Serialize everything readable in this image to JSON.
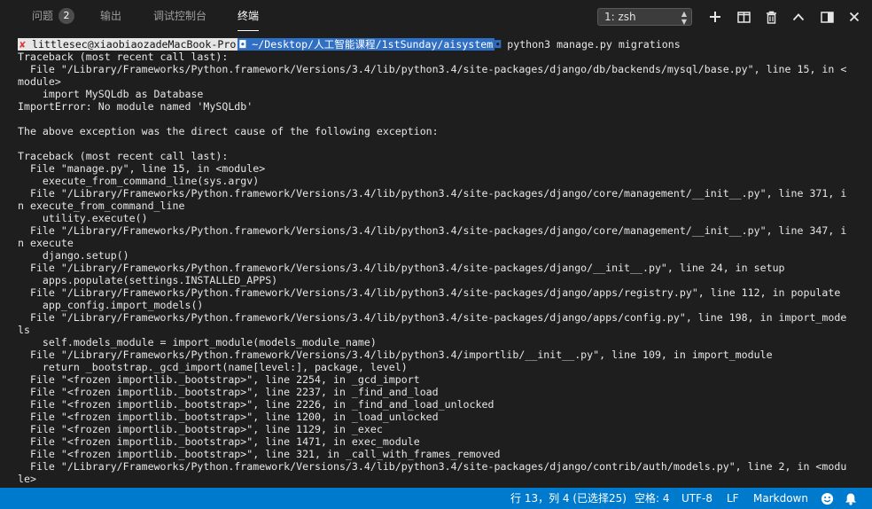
{
  "panel_tabs": [
    {
      "label": "问题",
      "badge": "2"
    },
    {
      "label": "输出"
    },
    {
      "label": "调试控制台"
    },
    {
      "label": "终端",
      "active": true
    }
  ],
  "terminal_select": {
    "value": "1: zsh",
    "arrows": "▲\n▼"
  },
  "icons": {
    "new_terminal": "plus-icon",
    "split": "split-icon",
    "kill": "trash-icon",
    "maximize": "chevron-up-icon",
    "toggle_panel": "panel-layout-icon",
    "close": "close-icon"
  },
  "terminal": {
    "prompt": {
      "status_glyph": "✘",
      "user_host": "littlesec@xiaobiaozadeMacBook-Pro",
      "separator_glyph": "◘",
      "path": "~/Desktop/人工智能课程/1stSunday/aisystem",
      "command": "python3 manage.py migrations"
    },
    "output": [
      "Traceback (most recent call last):",
      "  File \"/Library/Frameworks/Python.framework/Versions/3.4/lib/python3.4/site-packages/django/db/backends/mysql/base.py\", line 15, in <",
      "module>",
      "    import MySQLdb as Database",
      "ImportError: No module named 'MySQLdb'",
      "",
      "The above exception was the direct cause of the following exception:",
      "",
      "Traceback (most recent call last):",
      "  File \"manage.py\", line 15, in <module>",
      "    execute_from_command_line(sys.argv)",
      "  File \"/Library/Frameworks/Python.framework/Versions/3.4/lib/python3.4/site-packages/django/core/management/__init__.py\", line 371, i",
      "n execute_from_command_line",
      "    utility.execute()",
      "  File \"/Library/Frameworks/Python.framework/Versions/3.4/lib/python3.4/site-packages/django/core/management/__init__.py\", line 347, i",
      "n execute",
      "    django.setup()",
      "  File \"/Library/Frameworks/Python.framework/Versions/3.4/lib/python3.4/site-packages/django/__init__.py\", line 24, in setup",
      "    apps.populate(settings.INSTALLED_APPS)",
      "  File \"/Library/Frameworks/Python.framework/Versions/3.4/lib/python3.4/site-packages/django/apps/registry.py\", line 112, in populate",
      "    app_config.import_models()",
      "  File \"/Library/Frameworks/Python.framework/Versions/3.4/lib/python3.4/site-packages/django/apps/config.py\", line 198, in import_mode",
      "ls",
      "    self.models_module = import_module(models_module_name)",
      "  File \"/Library/Frameworks/Python.framework/Versions/3.4/lib/python3.4/importlib/__init__.py\", line 109, in import_module",
      "    return _bootstrap._gcd_import(name[level:], package, level)",
      "  File \"<frozen importlib._bootstrap>\", line 2254, in _gcd_import",
      "  File \"<frozen importlib._bootstrap>\", line 2237, in _find_and_load",
      "  File \"<frozen importlib._bootstrap>\", line 2226, in _find_and_load_unlocked",
      "  File \"<frozen importlib._bootstrap>\", line 1200, in _load_unlocked",
      "  File \"<frozen importlib._bootstrap>\", line 1129, in _exec",
      "  File \"<frozen importlib._bootstrap>\", line 1471, in exec_module",
      "  File \"<frozen importlib._bootstrap>\", line 321, in _call_with_frames_removed",
      "  File \"/Library/Frameworks/Python.framework/Versions/3.4/lib/python3.4/site-packages/django/contrib/auth/models.py\", line 2, in <modu",
      "le>"
    ]
  },
  "status_bar": {
    "cursor_position": "行 13，列 4 (已选择25)",
    "indentation": "空格: 4",
    "encoding": "UTF-8",
    "eol": "LF",
    "language": "Markdown",
    "feedback_icon": "smiley-icon",
    "notifications_icon": "bell-icon"
  },
  "colors": {
    "background": "#1e1e1e",
    "status_bar": "#007acc",
    "prompt_path_bg": "#2f6fc4",
    "error_glyph": "#e0333a"
  }
}
